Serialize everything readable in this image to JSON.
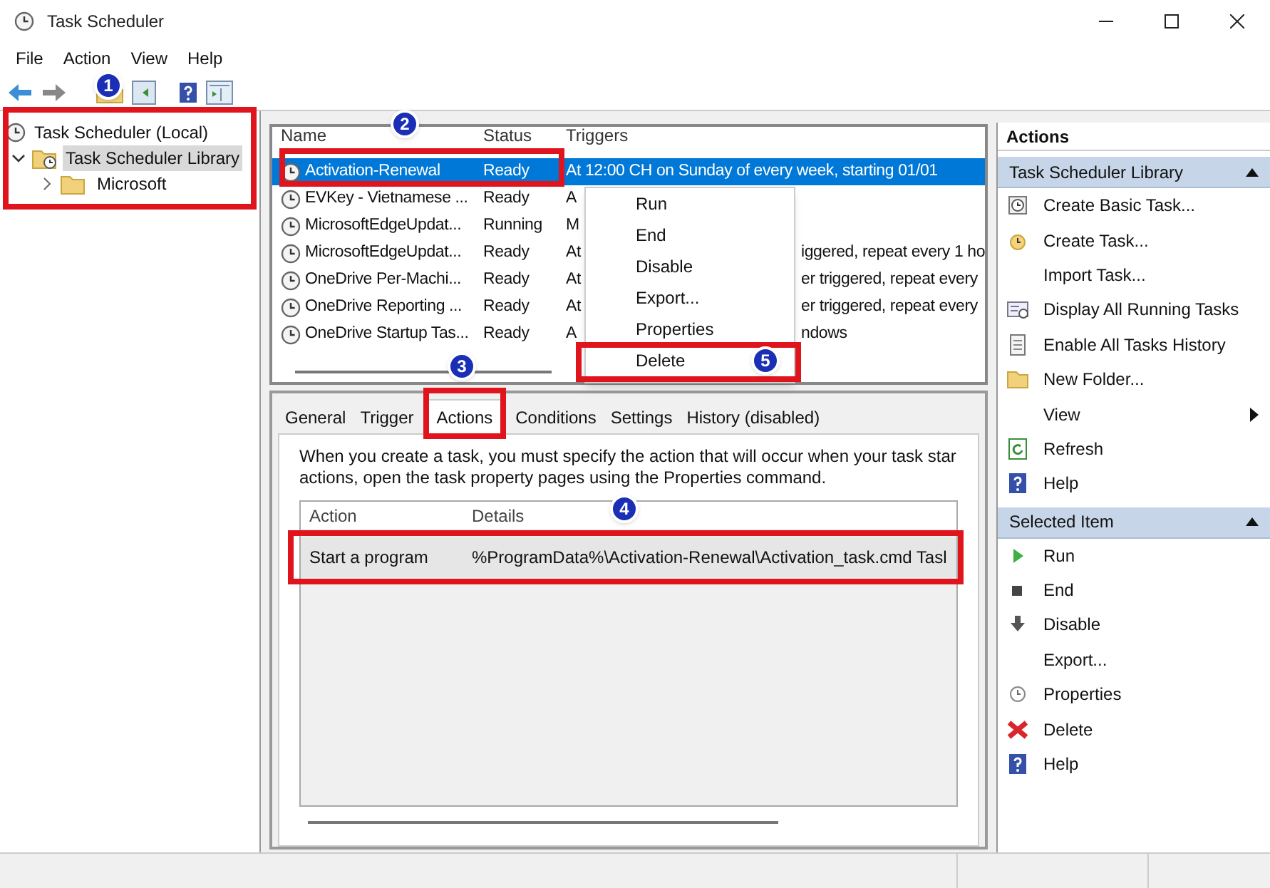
{
  "window": {
    "title": "Task Scheduler"
  },
  "menu": [
    "File",
    "Action",
    "View",
    "Help"
  ],
  "tree": [
    {
      "label": "Task Scheduler (Local)",
      "selected": false,
      "children": [
        {
          "label": "Task Scheduler Library",
          "selected": true,
          "expanded": true,
          "children": [
            {
              "label": "Microsoft",
              "selected": false,
              "expanded": false
            }
          ]
        }
      ]
    }
  ],
  "task_list": {
    "columns": [
      "Name",
      "Status",
      "Triggers"
    ],
    "rows": [
      {
        "name": "Activation-Renewal",
        "status": "Ready",
        "triggers": "At 12:00 CH on Sunday of every week, starting 01/01",
        "triggers_tail": "",
        "selected": true
      },
      {
        "name": "EVKey - Vietnamese ...",
        "status": "Ready",
        "triggers": "A",
        "triggers_tail": "",
        "selected": false
      },
      {
        "name": "MicrosoftEdgeUpdat...",
        "status": "Running",
        "triggers": "M",
        "triggers_tail": "",
        "selected": false
      },
      {
        "name": "MicrosoftEdgeUpdat...",
        "status": "Ready",
        "triggers": "At",
        "triggers_tail": "iggered, repeat every 1 ho",
        "selected": false
      },
      {
        "name": "OneDrive Per-Machi...",
        "status": "Ready",
        "triggers": "At",
        "triggers_tail": "er triggered, repeat every",
        "selected": false
      },
      {
        "name": "OneDrive Reporting ...",
        "status": "Ready",
        "triggers": "At",
        "triggers_tail": "er triggered, repeat every",
        "selected": false
      },
      {
        "name": "OneDrive Startup Tas...",
        "status": "Ready",
        "triggers": "A",
        "triggers_tail": "ndows",
        "selected": false
      }
    ]
  },
  "context_menu": [
    "Run",
    "End",
    "Disable",
    "Export...",
    "Properties",
    "Delete"
  ],
  "detail_tabs": [
    {
      "label": "General",
      "selected": false
    },
    {
      "label": "Trigger",
      "selected": false
    },
    {
      "label": "Actions",
      "selected": true
    },
    {
      "label": "Conditions",
      "selected": false
    },
    {
      "label": "Settings",
      "selected": false
    },
    {
      "label": "History (disabled)",
      "selected": false
    }
  ],
  "detail": {
    "description": [
      "When you create a task, you must specify the action that will occur when your task star",
      "actions, open the task property pages using the Properties command."
    ],
    "columns": [
      "Action",
      "Details"
    ],
    "rows": [
      {
        "action": "Start a program",
        "details": "%ProgramData%\\Activation-Renewal\\Activation_task.cmd Tasl"
      }
    ]
  },
  "actions_pane": {
    "title": "Actions",
    "sections": [
      {
        "title": "Task Scheduler Library",
        "items": [
          {
            "label": "Create Basic Task...",
            "kind": "basic"
          },
          {
            "label": "Create Task...",
            "kind": "task"
          },
          {
            "label": "Import Task...",
            "kind": "plain"
          },
          {
            "label": "Display All Running Tasks",
            "kind": "running"
          },
          {
            "label": "Enable All Tasks History",
            "kind": "history"
          },
          {
            "label": "New Folder...",
            "kind": "folder"
          },
          {
            "label": "View",
            "kind": "submenu"
          },
          {
            "label": "Refresh",
            "kind": "refresh"
          },
          {
            "label": "Help",
            "kind": "help"
          }
        ]
      },
      {
        "title": "Selected Item",
        "items": [
          {
            "label": "Run",
            "kind": "run"
          },
          {
            "label": "End",
            "kind": "end"
          },
          {
            "label": "Disable",
            "kind": "disable"
          },
          {
            "label": "Export...",
            "kind": "plain"
          },
          {
            "label": "Properties",
            "kind": "clock"
          },
          {
            "label": "Delete",
            "kind": "delete"
          },
          {
            "label": "Help",
            "kind": "help"
          }
        ]
      }
    ]
  },
  "callouts": [
    "1",
    "2",
    "3",
    "4",
    "5"
  ]
}
